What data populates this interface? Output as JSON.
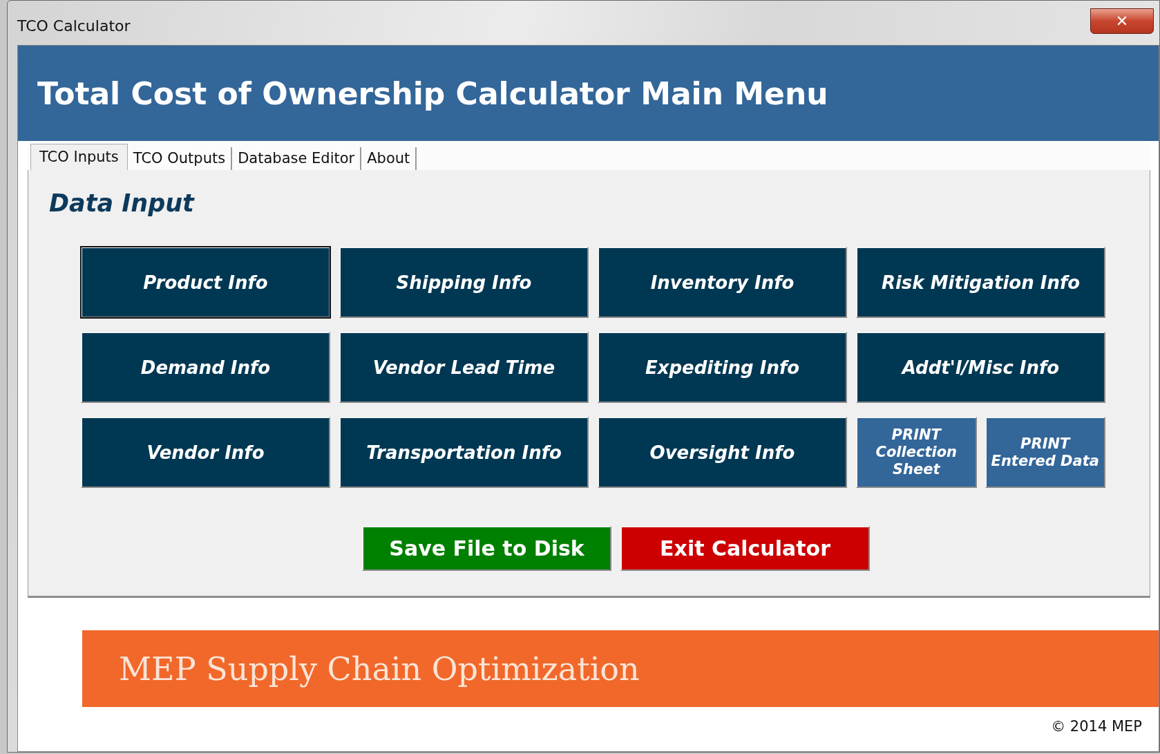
{
  "window": {
    "title": "TCO Calculator",
    "close": "✕"
  },
  "header": {
    "title": "Total Cost of Ownership Calculator Main Menu"
  },
  "tabs": [
    {
      "label": "TCO Inputs",
      "selected": true
    },
    {
      "label": "TCO Outputs",
      "selected": false
    },
    {
      "label": "Database Editor",
      "selected": false
    },
    {
      "label": "About",
      "selected": false
    }
  ],
  "section_title": "Data Input",
  "buttons": [
    {
      "label": "Product Info",
      "kind": "menu",
      "focused": true
    },
    {
      "label": "Shipping Info",
      "kind": "menu",
      "focused": false
    },
    {
      "label": "Inventory Info",
      "kind": "menu",
      "focused": false
    },
    {
      "label": "Risk Mitigation Info",
      "kind": "menu",
      "focused": false
    },
    {
      "label": "Demand Info",
      "kind": "menu",
      "focused": false
    },
    {
      "label": "Vendor Lead Time",
      "kind": "menu",
      "focused": false
    },
    {
      "label": "Expediting Info",
      "kind": "menu",
      "focused": false
    },
    {
      "label": "Addt'l/Misc Info",
      "kind": "menu",
      "focused": false
    },
    {
      "label": "Vendor Info",
      "kind": "menu",
      "focused": false
    },
    {
      "label": "Transportation Info",
      "kind": "menu",
      "focused": false
    },
    {
      "label": "Oversight Info",
      "kind": "menu",
      "focused": false
    },
    {
      "label": "PRINT Collection Sheet",
      "kind": "print",
      "focused": false
    },
    {
      "label": "PRINT Entered Data",
      "kind": "print",
      "focused": false
    }
  ],
  "actions": [
    {
      "label": "Save File to Disk",
      "kind": "save"
    },
    {
      "label": "Exit Calculator",
      "kind": "exit"
    }
  ],
  "banner": "MEP Supply Chain Optimization",
  "copyright": "© 2014 MEP"
}
